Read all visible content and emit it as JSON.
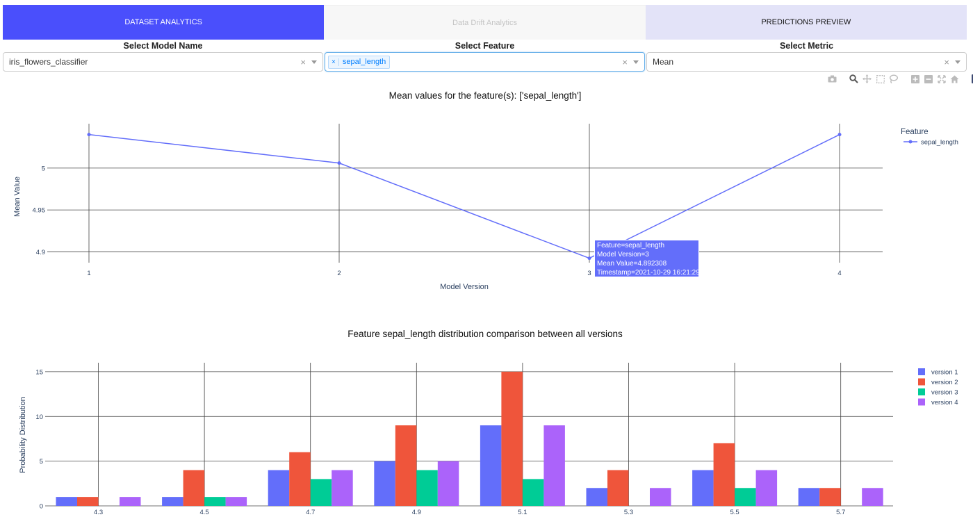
{
  "tabs": [
    {
      "label": "Dataset Analytics"
    },
    {
      "label": "Data Drift Analytics"
    },
    {
      "label": "PREDICTIONS PREVIEW"
    }
  ],
  "selectors": {
    "model": {
      "label": "Select Model Name",
      "value": "iris_flowers_classifier"
    },
    "feature": {
      "label": "Select Feature",
      "tags": [
        "sepal_length"
      ]
    },
    "metric": {
      "label": "Select Metric",
      "value": "Mean"
    }
  },
  "modebar": [
    "camera-icon",
    "zoom-icon",
    "pan-icon",
    "box-select-icon",
    "lasso-icon",
    "zoom-in-icon",
    "zoom-out-icon",
    "autoscale-icon",
    "reset-axes-icon",
    "plotly-logo-icon"
  ],
  "colors": {
    "tab_active": "#4a4ffc",
    "series_1": "#636efa",
    "series_2": "#EF553B",
    "series_3": "#00cc96",
    "series_4": "#ab63fa"
  },
  "tooltip": {
    "lines": [
      "Feature=sepal_length",
      "Model Version=3",
      "Mean Value=4.892308",
      "Timestamp=2021-10-29 16:21:29"
    ]
  },
  "chart_data": [
    {
      "type": "line",
      "title": "Mean values for the feature(s): ['sepal_length']",
      "xlabel": "Model Version",
      "ylabel": "Mean Value",
      "legend_title": "Feature",
      "legend_position": "top-right",
      "x": [
        1,
        2,
        3,
        4
      ],
      "xticks": [
        "1",
        "2",
        "3",
        "4"
      ],
      "yticks": [
        "4.9",
        "4.95",
        "5"
      ],
      "ylim": [
        4.887,
        5.053
      ],
      "grid": true,
      "series": [
        {
          "name": "sepal_length",
          "values": [
            5.04,
            5.006,
            4.892308,
            5.04
          ]
        }
      ]
    },
    {
      "type": "bar",
      "title": "Feature sepal_length distribution comparison between all versions",
      "xlabel": "",
      "ylabel": "Probability Distribution",
      "legend_position": "top-right",
      "categories": [
        "4.3",
        "4.5",
        "4.7",
        "4.9",
        "5.1",
        "5.3",
        "5.5",
        "5.7"
      ],
      "yticks": [
        "0",
        "5",
        "10",
        "15"
      ],
      "ylim": [
        0,
        16
      ],
      "grid": true,
      "series": [
        {
          "name": "version 1",
          "values": [
            1,
            1,
            4,
            5,
            9,
            2,
            4,
            2
          ]
        },
        {
          "name": "version 2",
          "values": [
            1,
            4,
            6,
            9,
            15,
            4,
            7,
            2
          ]
        },
        {
          "name": "version 3",
          "values": [
            0,
            1,
            3,
            4,
            3,
            0,
            2,
            0
          ]
        },
        {
          "name": "version 4",
          "values": [
            1,
            1,
            4,
            5,
            9,
            2,
            4,
            2
          ]
        }
      ]
    }
  ]
}
